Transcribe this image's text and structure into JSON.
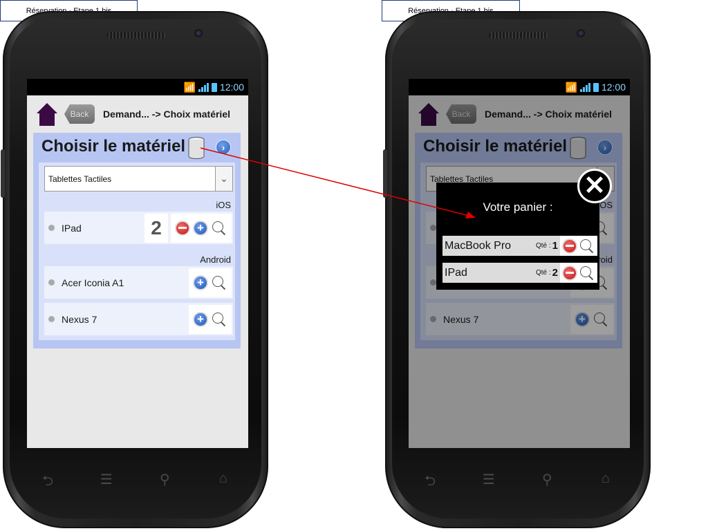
{
  "labels": {
    "left": "Réservation - Etape 1 bis",
    "right": "Réservation - Etape 1 bis"
  },
  "status": {
    "time": "12:00"
  },
  "header": {
    "back_label": "Back",
    "breadcrumb": "Demand... -> Choix matériel"
  },
  "page": {
    "title": "Choisir le matériel"
  },
  "filter": {
    "selected": "Tablettes Tactiles"
  },
  "groups": {
    "ios": "iOS",
    "android": "Android"
  },
  "items": [
    {
      "name": "IPad",
      "qty": "2"
    },
    {
      "name": "Acer Iconia A1"
    },
    {
      "name": "Nexus 7"
    }
  ],
  "popup": {
    "title": "Votre panier :",
    "qty_label": "Qté :",
    "rows": [
      {
        "name": "MacBook Pro",
        "qty": "1"
      },
      {
        "name": "IPad",
        "qty": "2"
      }
    ]
  },
  "colors": {
    "accent": "#b7c5f2",
    "home": "#3b0a45",
    "arrow": "#e00000"
  }
}
